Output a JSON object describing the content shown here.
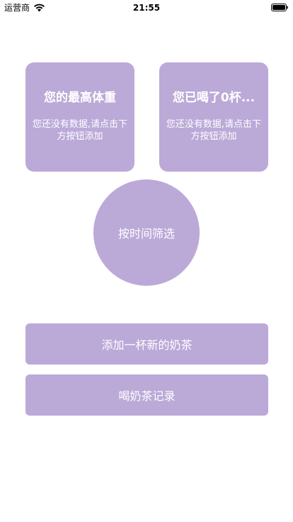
{
  "status_bar": {
    "carrier": "运营商",
    "time": "21:55",
    "icons": [
      "wifi-icon",
      "battery-icon"
    ]
  },
  "cards": {
    "max_weight": {
      "title": "您的最高体重",
      "subtitle": "您还没有数据,请点击下方按钮添加"
    },
    "cups": {
      "title": "您已喝了0杯...",
      "subtitle": "您还没有数据,请点击下方按钮添加"
    }
  },
  "filter": {
    "label": "按时间筛选"
  },
  "actions": {
    "add_label": "添加一杯新的奶茶",
    "records_label": "喝奶茶记录"
  },
  "colors": {
    "accent": "#bba9d8",
    "text_on_accent": "#ffffff",
    "background": "#ffffff"
  }
}
